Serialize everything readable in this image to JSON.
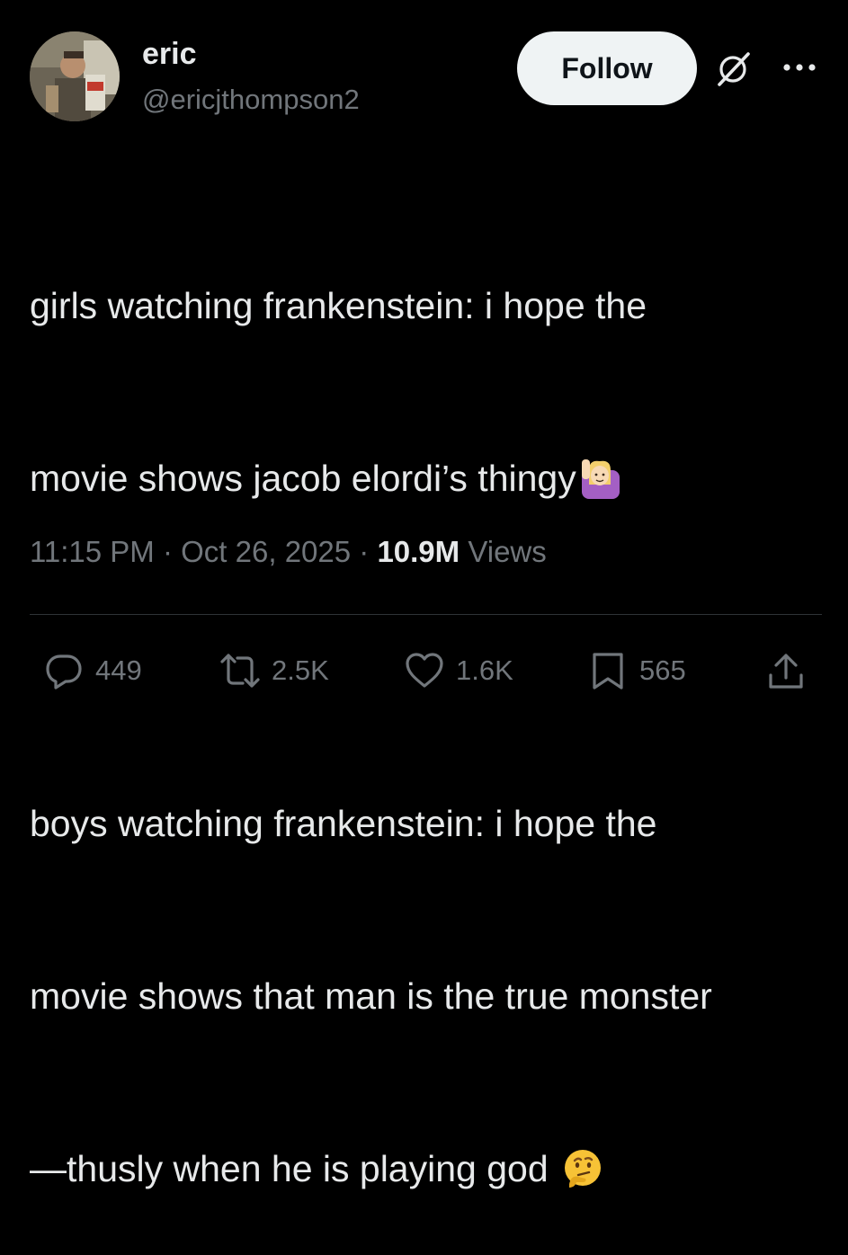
{
  "author": {
    "name": "eric",
    "handle": "@ericjthompson2"
  },
  "follow_label": "Follow",
  "tweet": {
    "line1": "girls watching frankenstein: i hope the",
    "line2": "movie shows jacob elordi’s thingy",
    "line3": "boys watching frankenstein: i hope the",
    "line4": "movie shows that man is the true monster",
    "line5": "—thusly when he is playing god"
  },
  "meta": {
    "time": "11:15 PM",
    "separator1": " · ",
    "date": "Oct 26, 2025",
    "separator2": " · ",
    "views_count": "10.9M",
    "views_label": " Views"
  },
  "actions": {
    "replies": "449",
    "reposts": "2.5K",
    "likes": "1.6K",
    "bookmarks": "565"
  },
  "icons": {
    "emoji1": "woman-raising-hand-emoji",
    "emoji2": "thinking-face-emoji",
    "grok": "grok-icon",
    "more": "more-icon",
    "reply": "reply-icon",
    "repost": "repost-icon",
    "like": "heart-icon",
    "bookmark": "bookmark-icon",
    "share": "share-icon"
  },
  "colors": {
    "background": "#000000",
    "text": "#e7e9ea",
    "secondary": "#71767b",
    "follow_bg": "#eff3f4"
  }
}
